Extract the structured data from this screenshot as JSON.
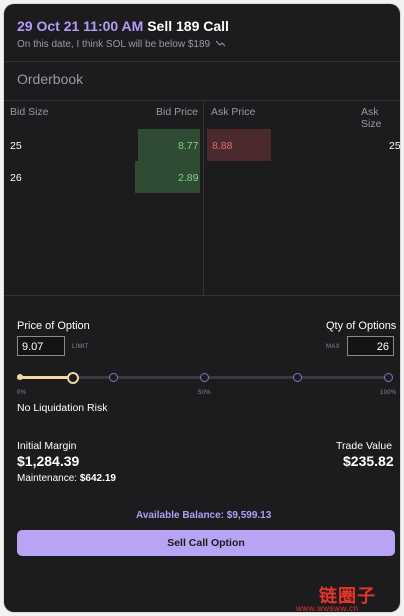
{
  "header": {
    "date": "29 Oct 21 11:00 AM",
    "action": "Sell 189 Call",
    "subtitle": "On this date, I think SOL will be below $189",
    "trend_icon": "trend-down-icon"
  },
  "orderbook": {
    "title": "Orderbook",
    "columns": {
      "bid_size": "Bid Size",
      "bid_price": "Bid Price",
      "ask_price": "Ask Price",
      "ask_size": "Ask Size"
    },
    "rows": [
      {
        "bid_size": "25",
        "bid_price": "8.77",
        "ask_price": "8.88",
        "ask_size": "25"
      },
      {
        "bid_size": "26",
        "bid_price": "2.89",
        "ask_price": "",
        "ask_size": ""
      }
    ]
  },
  "form": {
    "price_label": "Price of Option",
    "price_value": "9.07",
    "limit_tag": "LIMIT",
    "qty_label": "Qty of Options",
    "max_tag": "MAX",
    "qty_value": "26"
  },
  "slider": {
    "value_fraction": 0.15,
    "marks": [
      "0%",
      "50%",
      "100%"
    ],
    "risk_text": "No Liquidation Risk"
  },
  "summary": {
    "initial_margin_label": "Initial Margin",
    "initial_margin_value": "$1,284.39",
    "maintenance_label": "Maintenance:",
    "maintenance_value": "$642.19",
    "trade_value_label": "Trade Value",
    "trade_value_value": "$235.82"
  },
  "balance": {
    "label": "Available Balance:",
    "value": "$9,599.13"
  },
  "submit_label": "Sell Call Option",
  "watermark": {
    "title": "链圈子",
    "url": "www.wwsww.cn"
  },
  "colors": {
    "accent": "#b59cf7",
    "button": "#b8a3f5",
    "bid": "#7fd17f",
    "ask": "#e06a6a",
    "slider_fill": "#f0d99a"
  }
}
